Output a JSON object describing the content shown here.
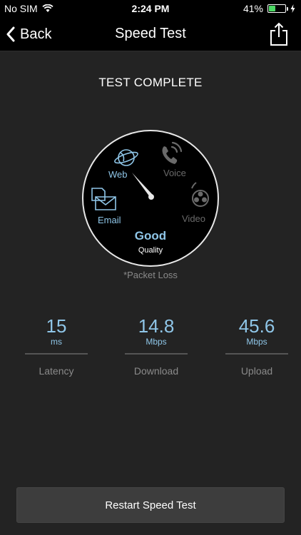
{
  "status_bar": {
    "carrier": "No SIM",
    "time": "2:24 PM",
    "battery_percent": "41%",
    "battery_level": 0.41,
    "icons": [
      "wifi-icon",
      "battery-icon",
      "charging-bolt-icon"
    ]
  },
  "nav": {
    "back_label": "Back",
    "title": "Speed Test",
    "share_icon": "share-icon"
  },
  "main": {
    "status": "TEST COMPLETE",
    "gauge": {
      "categories": {
        "web": "Web",
        "voice": "Voice",
        "email": "Email",
        "video": "Video"
      },
      "active_categories": [
        "Web",
        "Email"
      ],
      "rating": "Good",
      "rating_label": "Quality",
      "icons": [
        "globe-icon",
        "phone-icon",
        "email-icon",
        "film-reel-icon"
      ]
    },
    "footnote": "*Packet Loss",
    "stats": [
      {
        "value": "15",
        "unit": "ms",
        "label": "Latency"
      },
      {
        "value": "14.8",
        "unit": "Mbps",
        "label": "Download"
      },
      {
        "value": "45.6",
        "unit": "Mbps",
        "label": "Upload"
      }
    ],
    "restart_label": "Restart Speed Test"
  },
  "colors": {
    "background": "#232323",
    "bar_background": "#000000",
    "accent": "#8fc6e8",
    "inactive": "#6a6a6a",
    "battery": "#4cd964"
  }
}
